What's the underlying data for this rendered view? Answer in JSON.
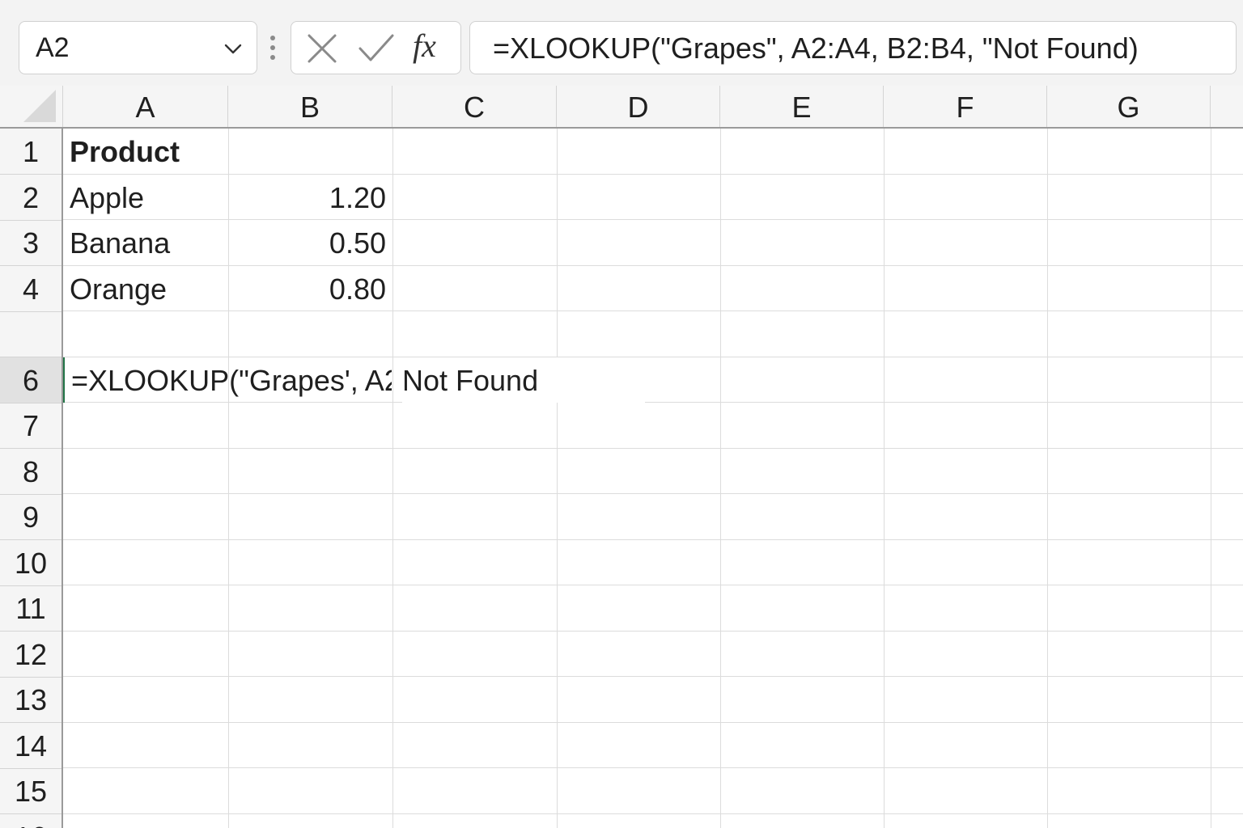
{
  "formula_bar": {
    "name_box": "A2",
    "formula": "=XLOOKUP(\"Grapes\", A2:A4, B2:B4, \"Not Found)",
    "fx_label": "fx"
  },
  "columns": [
    "A",
    "B",
    "C",
    "D",
    "E",
    "F",
    "G"
  ],
  "rows": [
    "1",
    "2",
    "3",
    "4",
    "",
    "6",
    "7",
    "8",
    "9",
    "10",
    "11",
    "12",
    "13",
    "14",
    "15",
    "16"
  ],
  "cells": {
    "A1": "Product",
    "A2": "Apple",
    "B2": "1.20",
    "A3": "Banana",
    "B3": "0.50",
    "A4": "Orange",
    "B4": "0.80",
    "A6": "=XLOOKUP(\"Grapes', A2",
    "C6": "Not Found"
  },
  "colors": {
    "active_cell_border": "#217346",
    "header_background": "#f5f5f5",
    "gridline": "#dcdcdc"
  },
  "icons": [
    "chevron-down-icon",
    "more-vertical-icon",
    "cancel-icon",
    "enter-icon",
    "insert-function-icon"
  ]
}
